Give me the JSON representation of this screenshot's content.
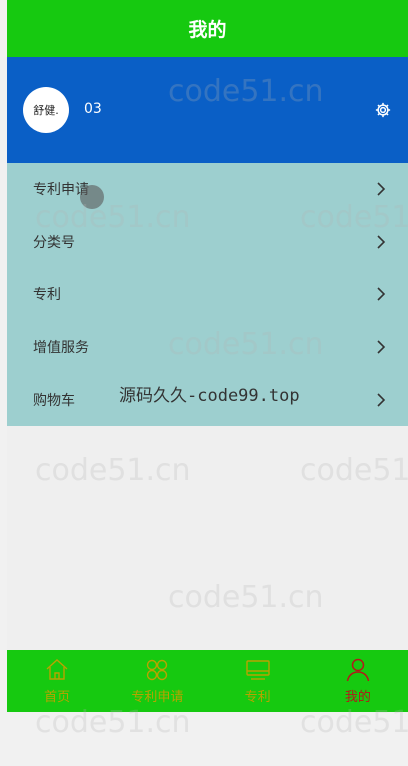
{
  "header": {
    "title": "我的"
  },
  "profile": {
    "avatar_text": "舒健.",
    "username": "03"
  },
  "menu": {
    "items": [
      {
        "label": "专利申请"
      },
      {
        "label": "分类号"
      },
      {
        "label": "专利"
      },
      {
        "label": "增值服务"
      },
      {
        "label": "购物车"
      }
    ]
  },
  "overlay_text": "源码久久-code99.top",
  "watermark_text": "code51.cn",
  "tabbar": {
    "tabs": [
      {
        "label": "首页",
        "icon": "home-icon"
      },
      {
        "label": "专利申请",
        "icon": "apps-icon"
      },
      {
        "label": "专利",
        "icon": "monitor-icon"
      },
      {
        "label": "我的",
        "icon": "person-icon",
        "active": true
      }
    ]
  },
  "colors": {
    "header": "#16c910",
    "profile": "#0a5fc6",
    "menu": "#9dcfcf",
    "tab_text": "#b8a300",
    "tab_active": "#b3191a"
  }
}
